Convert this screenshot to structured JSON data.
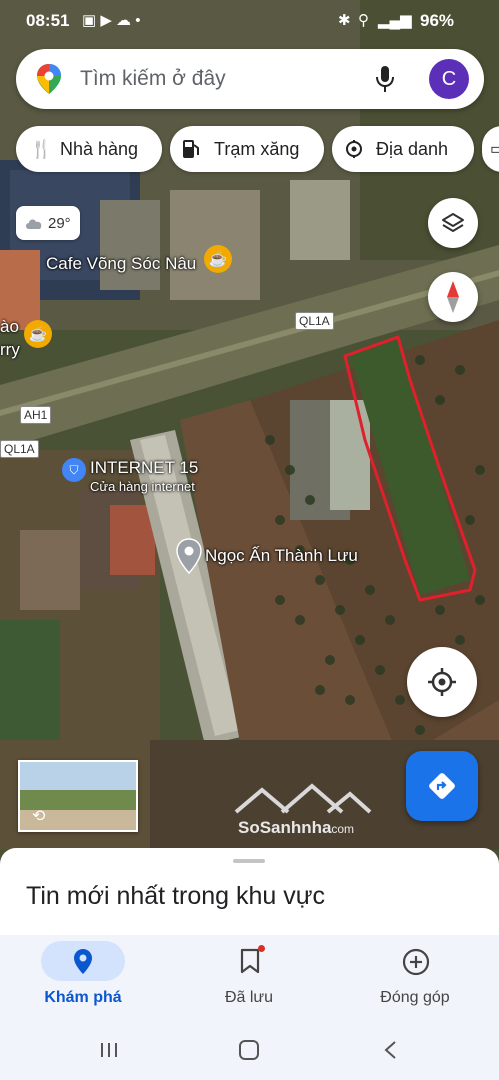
{
  "status_bar": {
    "time": "08:51",
    "battery": "96%"
  },
  "search": {
    "placeholder": "Tìm kiếm ở đây",
    "avatar_letter": "C"
  },
  "chips": [
    {
      "label": "Nhà hàng",
      "icon": "fork-knife-icon"
    },
    {
      "label": "Trạm xăng",
      "icon": "gas-pump-icon"
    },
    {
      "label": "Địa danh",
      "icon": "landmark-icon"
    }
  ],
  "weather": {
    "temp": "29°"
  },
  "map_labels": {
    "cafe": "Cafe Võng Sóc Nâu",
    "cafe_left_line1": "ào",
    "cafe_left_line2": "rry",
    "road_ql1a_top": "QL1A",
    "road_ql1a_left": "QL1A",
    "road_ah1": "AH1",
    "internet_name": "INTERNET 15",
    "internet_type": "Cửa hàng internet",
    "pin_place": "Ngọc Ấn Thành Lưu"
  },
  "watermark": {
    "text": "SoSanhnha",
    "suffix": ".com"
  },
  "sheet": {
    "title": "Tin mới nhất trong khu vực"
  },
  "bottom_nav": [
    {
      "label": "Khám phá",
      "icon": "location-pin-icon",
      "active": true
    },
    {
      "label": "Đã lưu",
      "icon": "bookmark-icon",
      "active": false
    },
    {
      "label": "Đóng góp",
      "icon": "add-circle-icon",
      "active": false
    }
  ],
  "colors": {
    "accent": "#1a73e8",
    "avatar": "#5b2fb8",
    "boundary": "#e0202a"
  }
}
